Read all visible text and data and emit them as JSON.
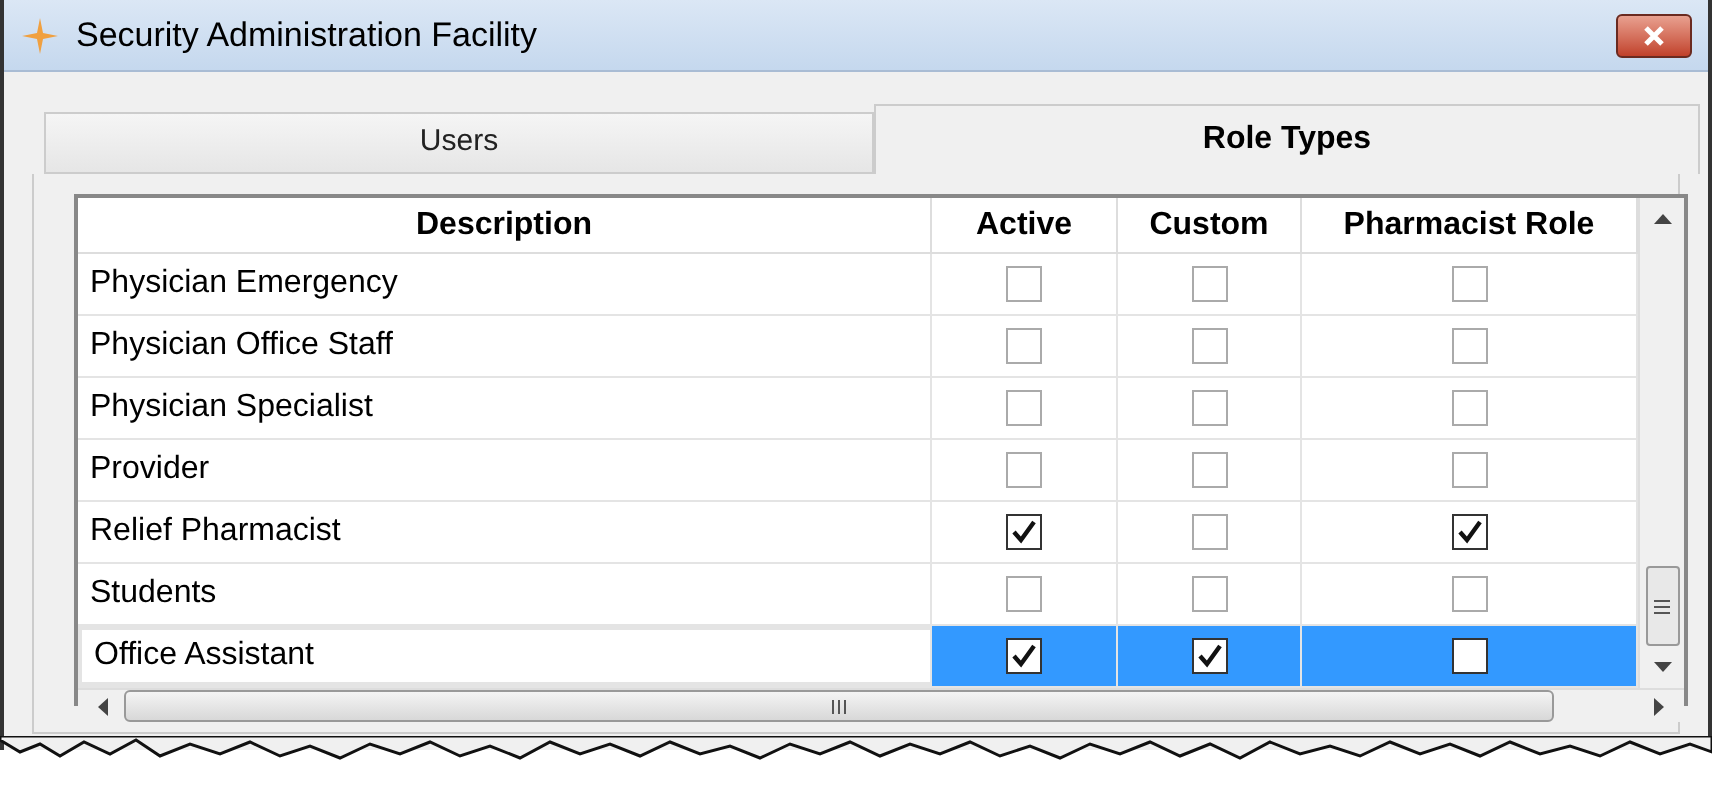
{
  "window": {
    "title": "Security Administration Facility"
  },
  "tabs": [
    {
      "label": "Users",
      "selected": false
    },
    {
      "label": "Role Types",
      "selected": true
    }
  ],
  "table": {
    "columns": [
      "Description",
      "Active",
      "Custom",
      "Pharmacist Role"
    ],
    "rows": [
      {
        "description": "Physician Emergency",
        "active": false,
        "custom": false,
        "pharmacist_role": false,
        "selected": false
      },
      {
        "description": "Physician Office Staff",
        "active": false,
        "custom": false,
        "pharmacist_role": false,
        "selected": false
      },
      {
        "description": "Physician Specialist",
        "active": false,
        "custom": false,
        "pharmacist_role": false,
        "selected": false
      },
      {
        "description": "Provider",
        "active": false,
        "custom": false,
        "pharmacist_role": false,
        "selected": false
      },
      {
        "description": "Relief Pharmacist",
        "active": true,
        "custom": false,
        "pharmacist_role": true,
        "selected": false
      },
      {
        "description": "Students",
        "active": false,
        "custom": false,
        "pharmacist_role": false,
        "selected": false
      },
      {
        "description": "Office Assistant",
        "active": true,
        "custom": true,
        "pharmacist_role": false,
        "selected": true
      }
    ]
  }
}
